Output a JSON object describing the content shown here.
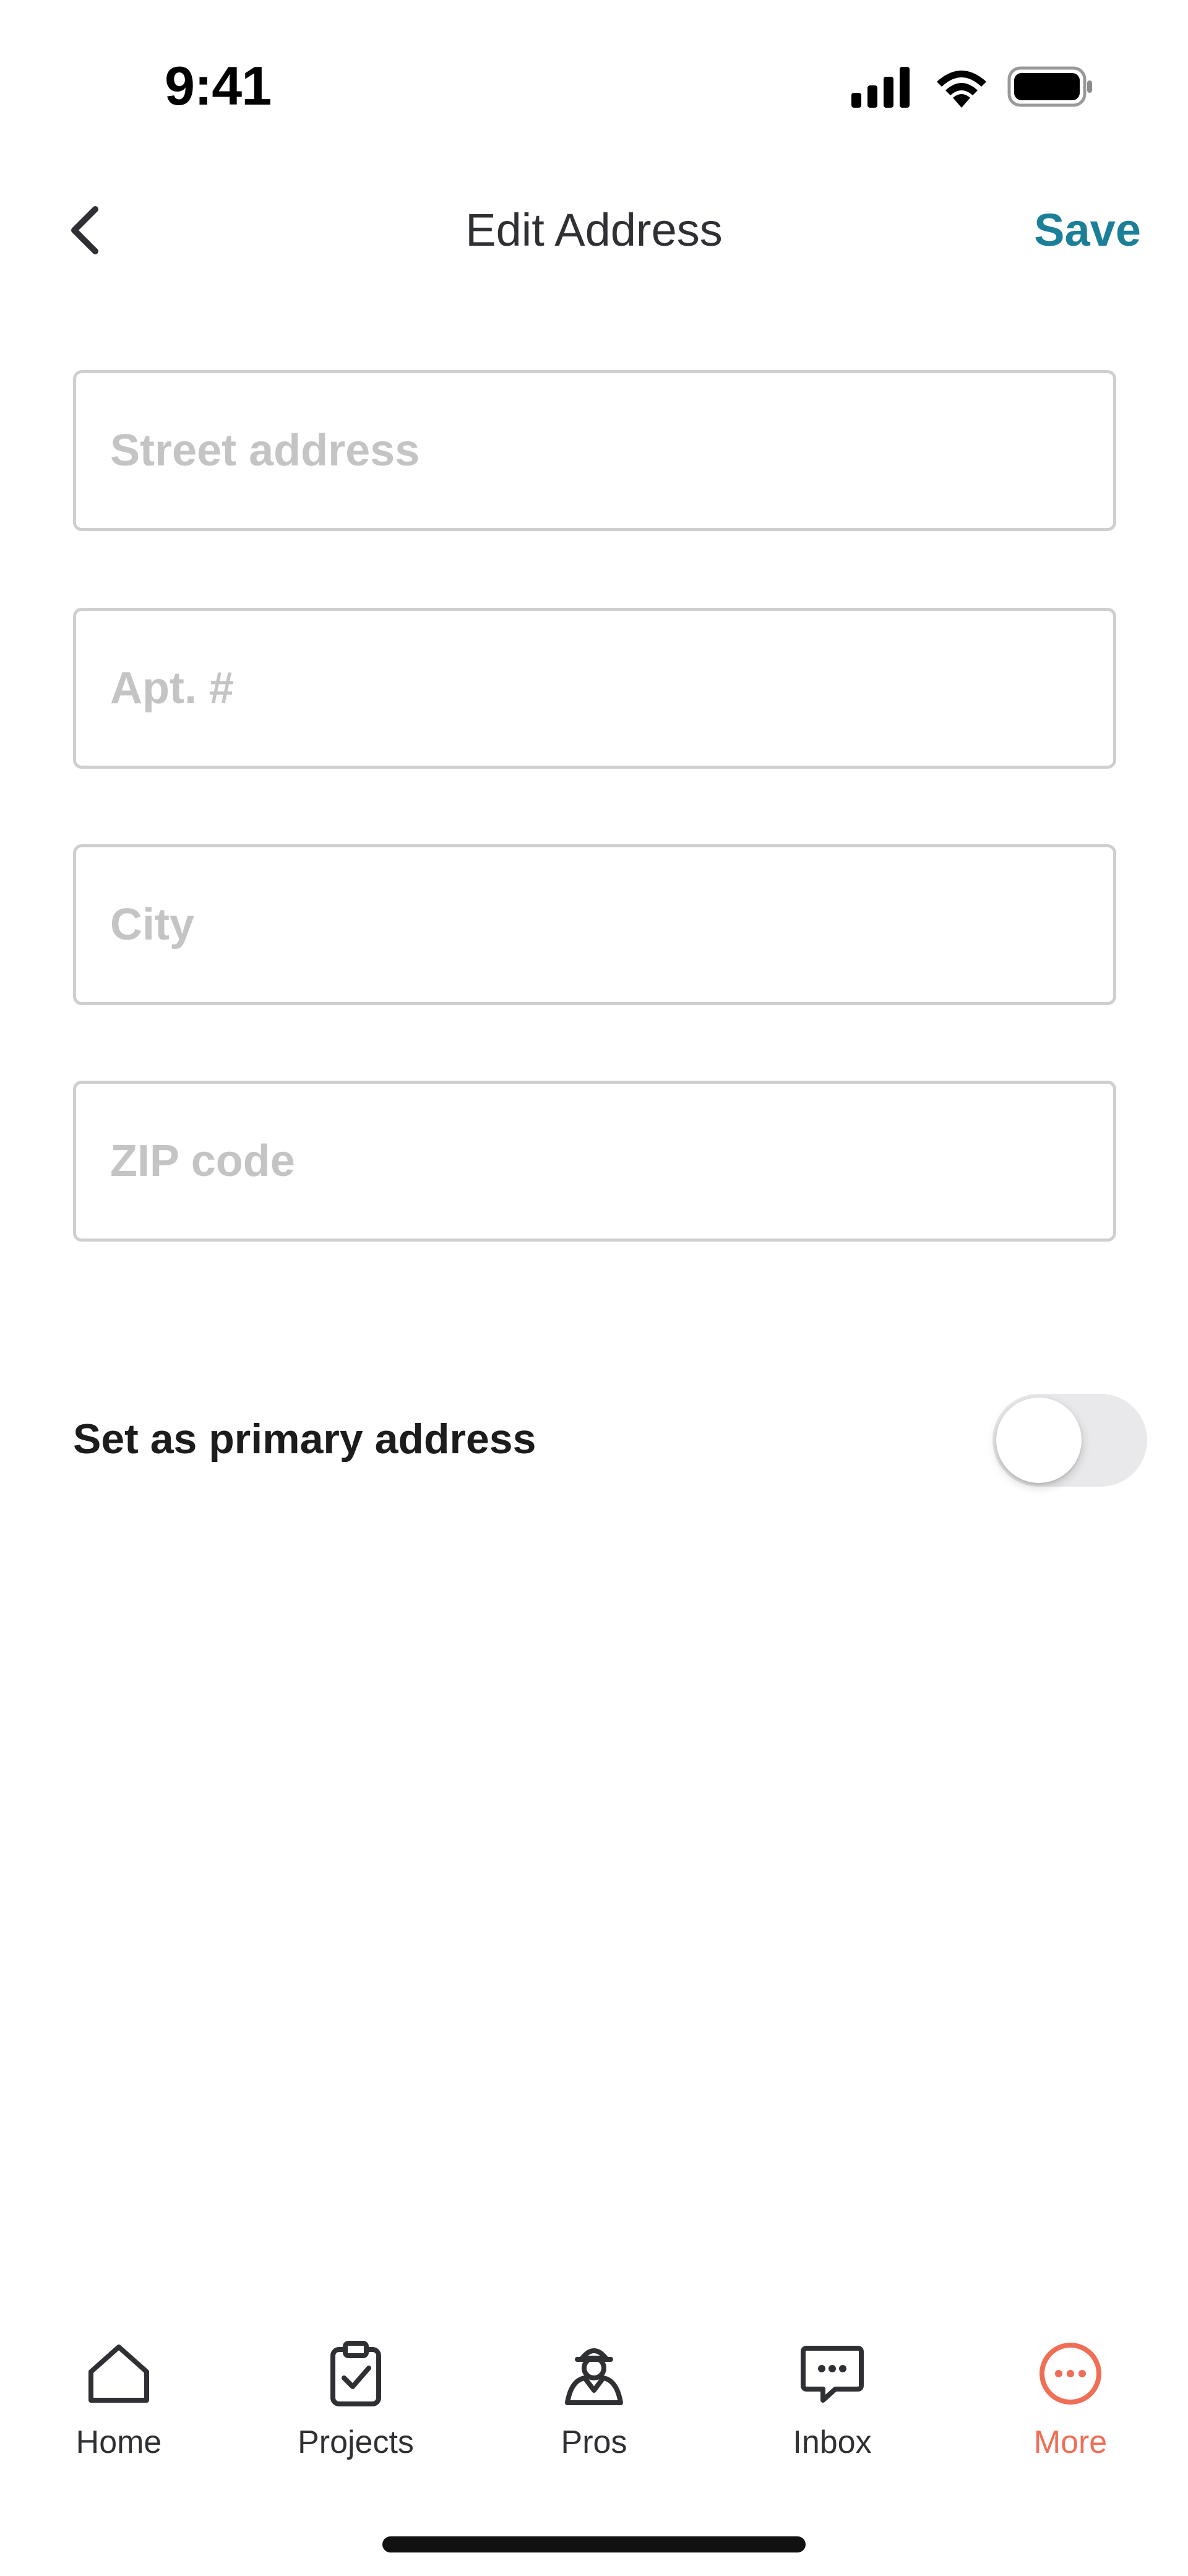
{
  "status_bar": {
    "time": "9:41",
    "icons": [
      "signal-icon",
      "wifi-icon",
      "battery-icon"
    ]
  },
  "nav": {
    "back_icon": "chevron-left-icon",
    "title": "Edit Address",
    "save_label": "Save"
  },
  "form": {
    "street": {
      "placeholder": "Street address",
      "value": ""
    },
    "apt": {
      "placeholder": "Apt. #",
      "value": ""
    },
    "city": {
      "placeholder": "City",
      "value": ""
    },
    "zip": {
      "placeholder": "ZIP code",
      "value": ""
    }
  },
  "primary_toggle": {
    "label": "Set as primary address",
    "on": false
  },
  "tabbar": {
    "items": [
      {
        "label": "Home",
        "icon": "home-icon",
        "active": false
      },
      {
        "label": "Projects",
        "icon": "clipboard-check-icon",
        "active": false
      },
      {
        "label": "Pros",
        "icon": "pro-person-icon",
        "active": false
      },
      {
        "label": "Inbox",
        "icon": "chat-bubble-icon",
        "active": false
      },
      {
        "label": "More",
        "icon": "more-circle-icon",
        "active": true
      }
    ]
  },
  "colors": {
    "accent": "#1b7f99",
    "active_tab": "#ef6e55",
    "text": "#2f3033",
    "placeholder": "#c4c4c4",
    "border": "#cfcfcf"
  }
}
